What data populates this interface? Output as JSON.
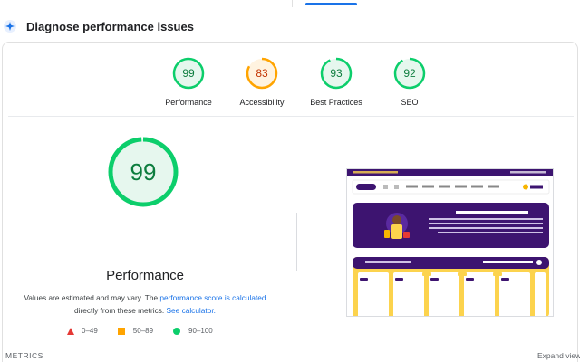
{
  "header": {
    "title": "Diagnose performance issues",
    "icon": "lighthouse-sparkle-icon"
  },
  "categories": [
    {
      "label": "Performance",
      "score": "99",
      "status": "good"
    },
    {
      "label": "Accessibility",
      "score": "83",
      "status": "average"
    },
    {
      "label": "Best Practices",
      "score": "93",
      "status": "good"
    },
    {
      "label": "SEO",
      "score": "92",
      "status": "good"
    }
  ],
  "main": {
    "score": "99",
    "title": "Performance",
    "note_prefix": "Values are estimated and may vary. The",
    "note_link1": "performance score is calculated",
    "note_middle": "directly from these metrics.",
    "note_link2": "See calculator."
  },
  "legend": [
    {
      "range": "0–49",
      "shape": "triangle"
    },
    {
      "range": "50–89",
      "shape": "square"
    },
    {
      "range": "90–100",
      "shape": "circle"
    }
  ],
  "footer": {
    "metrics_label": "METRICS",
    "expand_label": "Expand view"
  },
  "colors": {
    "good": "#0cce6b",
    "good_text": "#0d7d3e",
    "good_bg": "#e6f7ee",
    "average": "#ffa400",
    "average_text": "#c33300",
    "average_bg": "#fff3e0",
    "bad": "#e53935",
    "link": "#1a73e8",
    "purple": "#3d1470",
    "yellow": "#fcd34d"
  }
}
